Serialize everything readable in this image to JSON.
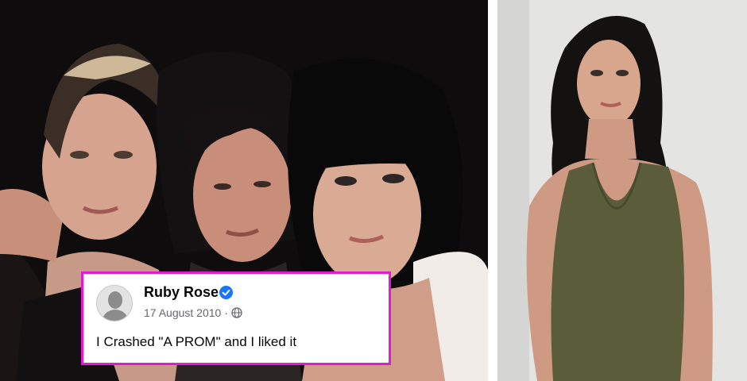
{
  "post": {
    "author": "Ruby Rose",
    "date": "17 August 2010",
    "separator": "·",
    "text": "I Crashed \"A PROM\" and I liked it"
  },
  "icons": {
    "verified": "verified-badge-icon",
    "privacy": "globe-icon",
    "avatar": "profile-avatar"
  },
  "colors": {
    "card_border": "#e21ad3",
    "verified_blue": "#1877f2",
    "meta_gray": "#65676b"
  }
}
